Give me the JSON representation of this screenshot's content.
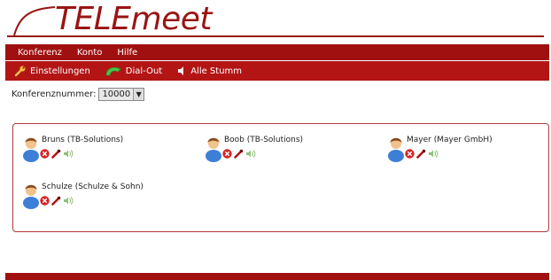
{
  "app": {
    "logo_text": "TELEmeet"
  },
  "menu": [
    {
      "label": "Konferenz"
    },
    {
      "label": "Konto"
    },
    {
      "label": "Hilfe"
    }
  ],
  "toolbar": {
    "settings_label": "Einstellungen",
    "dialout_label": "Dial-Out",
    "mute_all_label": "Alle Stumm"
  },
  "conference": {
    "label": "Konferenznummer:",
    "selected": "10000"
  },
  "participants": [
    {
      "name": "Bruns (TB-Solutions)"
    },
    {
      "name": "Boob (TB-Solutions)"
    },
    {
      "name": "Mayer (Mayer GmbH)"
    },
    {
      "name": "Schulze (Schulze & Sohn)"
    }
  ],
  "colors": {
    "brand": "#a01010",
    "toolbar": "#b31515",
    "panel_border": "#b03a3a"
  },
  "icons": {
    "participant": "user-avatar-icon",
    "kick": "remove-icon",
    "mute": "microphone-icon",
    "volume": "speaker-icon"
  }
}
